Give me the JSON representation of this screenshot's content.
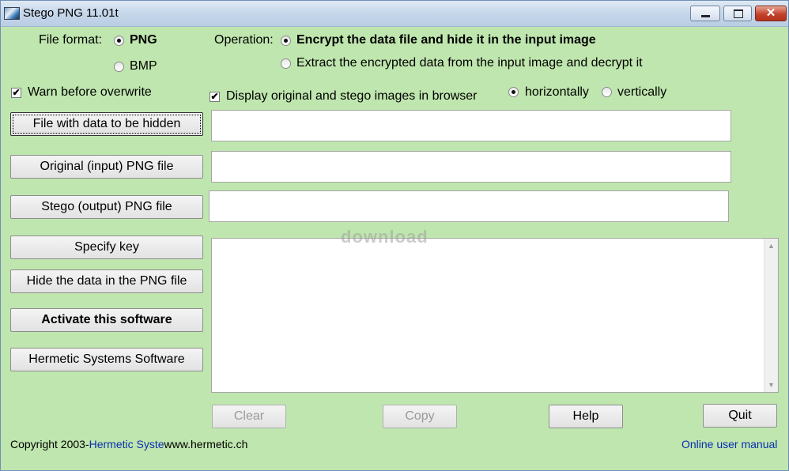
{
  "window": {
    "title": "Stego PNG 11.01t",
    "minimize_glyph": "",
    "maximize_glyph": "",
    "close_glyph": "✕"
  },
  "file_format": {
    "label": "File format:",
    "options": [
      "PNG",
      "BMP"
    ],
    "selected": "PNG"
  },
  "operation": {
    "label": "Operation:",
    "options": [
      "Encrypt the data file and hide it in the input image",
      "Extract the encrypted data from the input image and decrypt it"
    ],
    "selected": "Encrypt the data file and hide it in the input image"
  },
  "options": {
    "warn_overwrite": {
      "label": "Warn before overwrite",
      "checked": true
    },
    "display_browser": {
      "label": "Display original and stego images in browser",
      "checked": true
    },
    "orientation": {
      "options": [
        "horizontally",
        "vertically"
      ],
      "selected": "horizontally"
    },
    "check_glyph": "✔"
  },
  "buttons": {
    "data_file": "File with data to be hidden",
    "original_file": "Original (input) PNG file",
    "stego_file": "Stego (output) PNG file",
    "specify_key": "Specify key",
    "hide_data": "Hide the data in the PNG file",
    "activate": "Activate this software",
    "hermetic": "Hermetic Systems Software",
    "clear": "Clear",
    "copy": "Copy",
    "help": "Help",
    "quit": "Quit"
  },
  "fields": {
    "data_file_value": "",
    "original_file_value": "",
    "stego_file_value": "",
    "output_text": ""
  },
  "scrollbar": {
    "up": "▲",
    "down": "▼"
  },
  "watermark": "download",
  "footer": {
    "copyright_prefix": "Copyright 2003-",
    "company": "Hermetic Syste",
    "website": "www.hermetic.ch",
    "manual": "Online user manual"
  },
  "colors": {
    "background": "#bfe6ae",
    "link": "#0b2fb0"
  }
}
